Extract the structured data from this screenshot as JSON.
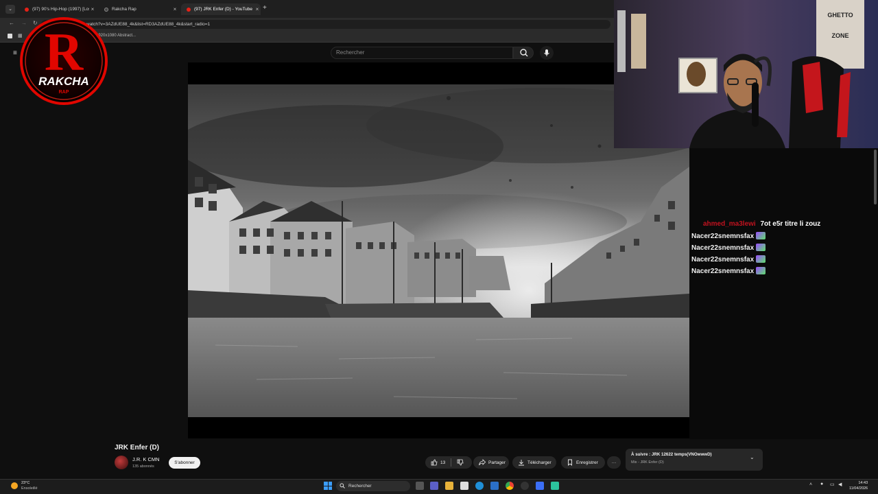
{
  "browser": {
    "tabs": [
      {
        "label": "(97) 90's Hip-Hop (1997) [Lost T..."
      },
      {
        "label": "Rakcha Rap"
      },
      {
        "label": "(97) JRK Enfer (D) - YouTube"
      }
    ],
    "url": "watch?v=3AZdUE88_4k&list=RD3AZdUE88_4k&start_radio=1",
    "bookmark": "1920x1080 Abstract..."
  },
  "youtube": {
    "search_placeholder": "Rechercher",
    "video_title": "JRK Enfer (D)",
    "channel_name": "J.R. K CMN",
    "channel_subs": "135 abonnés",
    "subscribe_label": "S'abonner",
    "likes": "13",
    "share_label": "Partager",
    "download_label": "Télécharger",
    "save_label": "Enregistrer",
    "more_label": "···",
    "up_next_title": "À suivre : JRK 12622 temps(VNOwwwD)",
    "up_next_sub": "Mix - JRK Enfer (D)"
  },
  "overlay": {
    "logo_text": "RAKCHA",
    "logo_sub": "RAP",
    "chat": [
      {
        "user": "ahmed_ma3lewi",
        "msg": "7ot e5r titre li zouz",
        "user_color": "#c1121f"
      },
      {
        "user": "Nacer22snemnsfax",
        "msg": "",
        "user_color": "#f2f2f2"
      },
      {
        "user": "Nacer22snemnsfax",
        "msg": "",
        "user_color": "#f2f2f2"
      },
      {
        "user": "Nacer22snemnsfax",
        "msg": "",
        "user_color": "#f2f2f2"
      },
      {
        "user": "Nacer22snemnsfax",
        "msg": "",
        "user_color": "#f2f2f2"
      }
    ]
  },
  "taskbar": {
    "weather_temp": "23°C",
    "weather_cond": "Ensoleillé",
    "search_label": "Rechercher",
    "time": "14:43",
    "date": "11/04/2026"
  }
}
